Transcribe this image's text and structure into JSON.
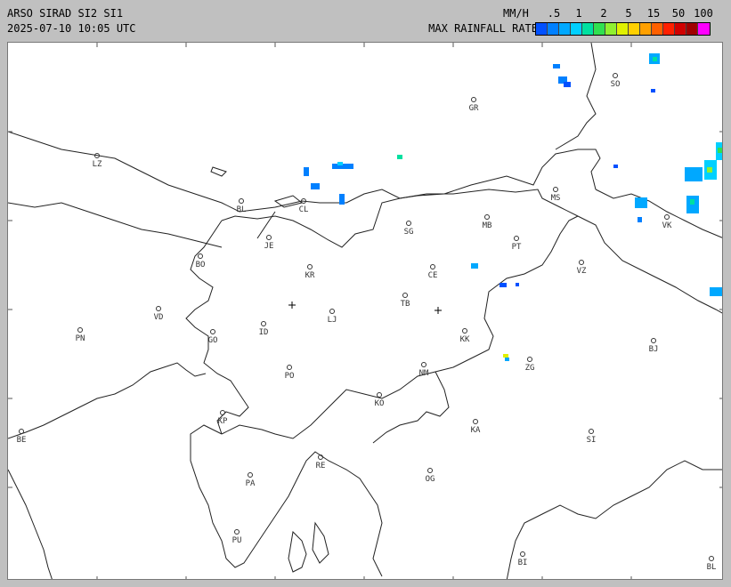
{
  "header": {
    "title": "ARSO SIRAD SI2 SI1",
    "timestamp": "2025-07-10 10:05 UTC"
  },
  "legend": {
    "unit": "MM/H",
    "title": "MAX RAINFALL RATE",
    "ticks": [
      ".5",
      "1",
      "2",
      "5",
      "15",
      "50",
      "100"
    ],
    "colors": [
      "#0050ff",
      "#0080ff",
      "#00a8ff",
      "#00d0ff",
      "#00e0a0",
      "#30e050",
      "#90f030",
      "#e0f000",
      "#ffd000",
      "#ffa000",
      "#ff6000",
      "#ff2000",
      "#d00000",
      "#a00000",
      "#ff00ff"
    ]
  },
  "map": {
    "cities": [
      {
        "code": "GR"
      },
      {
        "code": "SO"
      },
      {
        "code": "LZ"
      },
      {
        "code": "BL"
      },
      {
        "code": "CL"
      },
      {
        "code": "MS"
      },
      {
        "code": "MB"
      },
      {
        "code": "SG"
      },
      {
        "code": "VK"
      },
      {
        "code": "JE"
      },
      {
        "code": "PT"
      },
      {
        "code": "BO"
      },
      {
        "code": "KR"
      },
      {
        "code": "CE"
      },
      {
        "code": "VZ"
      },
      {
        "code": "VD"
      },
      {
        "code": "LJ"
      },
      {
        "code": "TB"
      },
      {
        "code": "PN"
      },
      {
        "code": "GO"
      },
      {
        "code": "ID"
      },
      {
        "code": "KK"
      },
      {
        "code": "BJ"
      },
      {
        "code": "PO"
      },
      {
        "code": "NM"
      },
      {
        "code": "ZG"
      },
      {
        "code": "KO"
      },
      {
        "code": "KP"
      },
      {
        "code": "KA"
      },
      {
        "code": "SI"
      },
      {
        "code": "BE"
      },
      {
        "code": "RE"
      },
      {
        "code": "PA"
      },
      {
        "code": "OG"
      },
      {
        "code": "PU"
      },
      {
        "code": "BI"
      },
      {
        "code": "BL"
      }
    ]
  }
}
